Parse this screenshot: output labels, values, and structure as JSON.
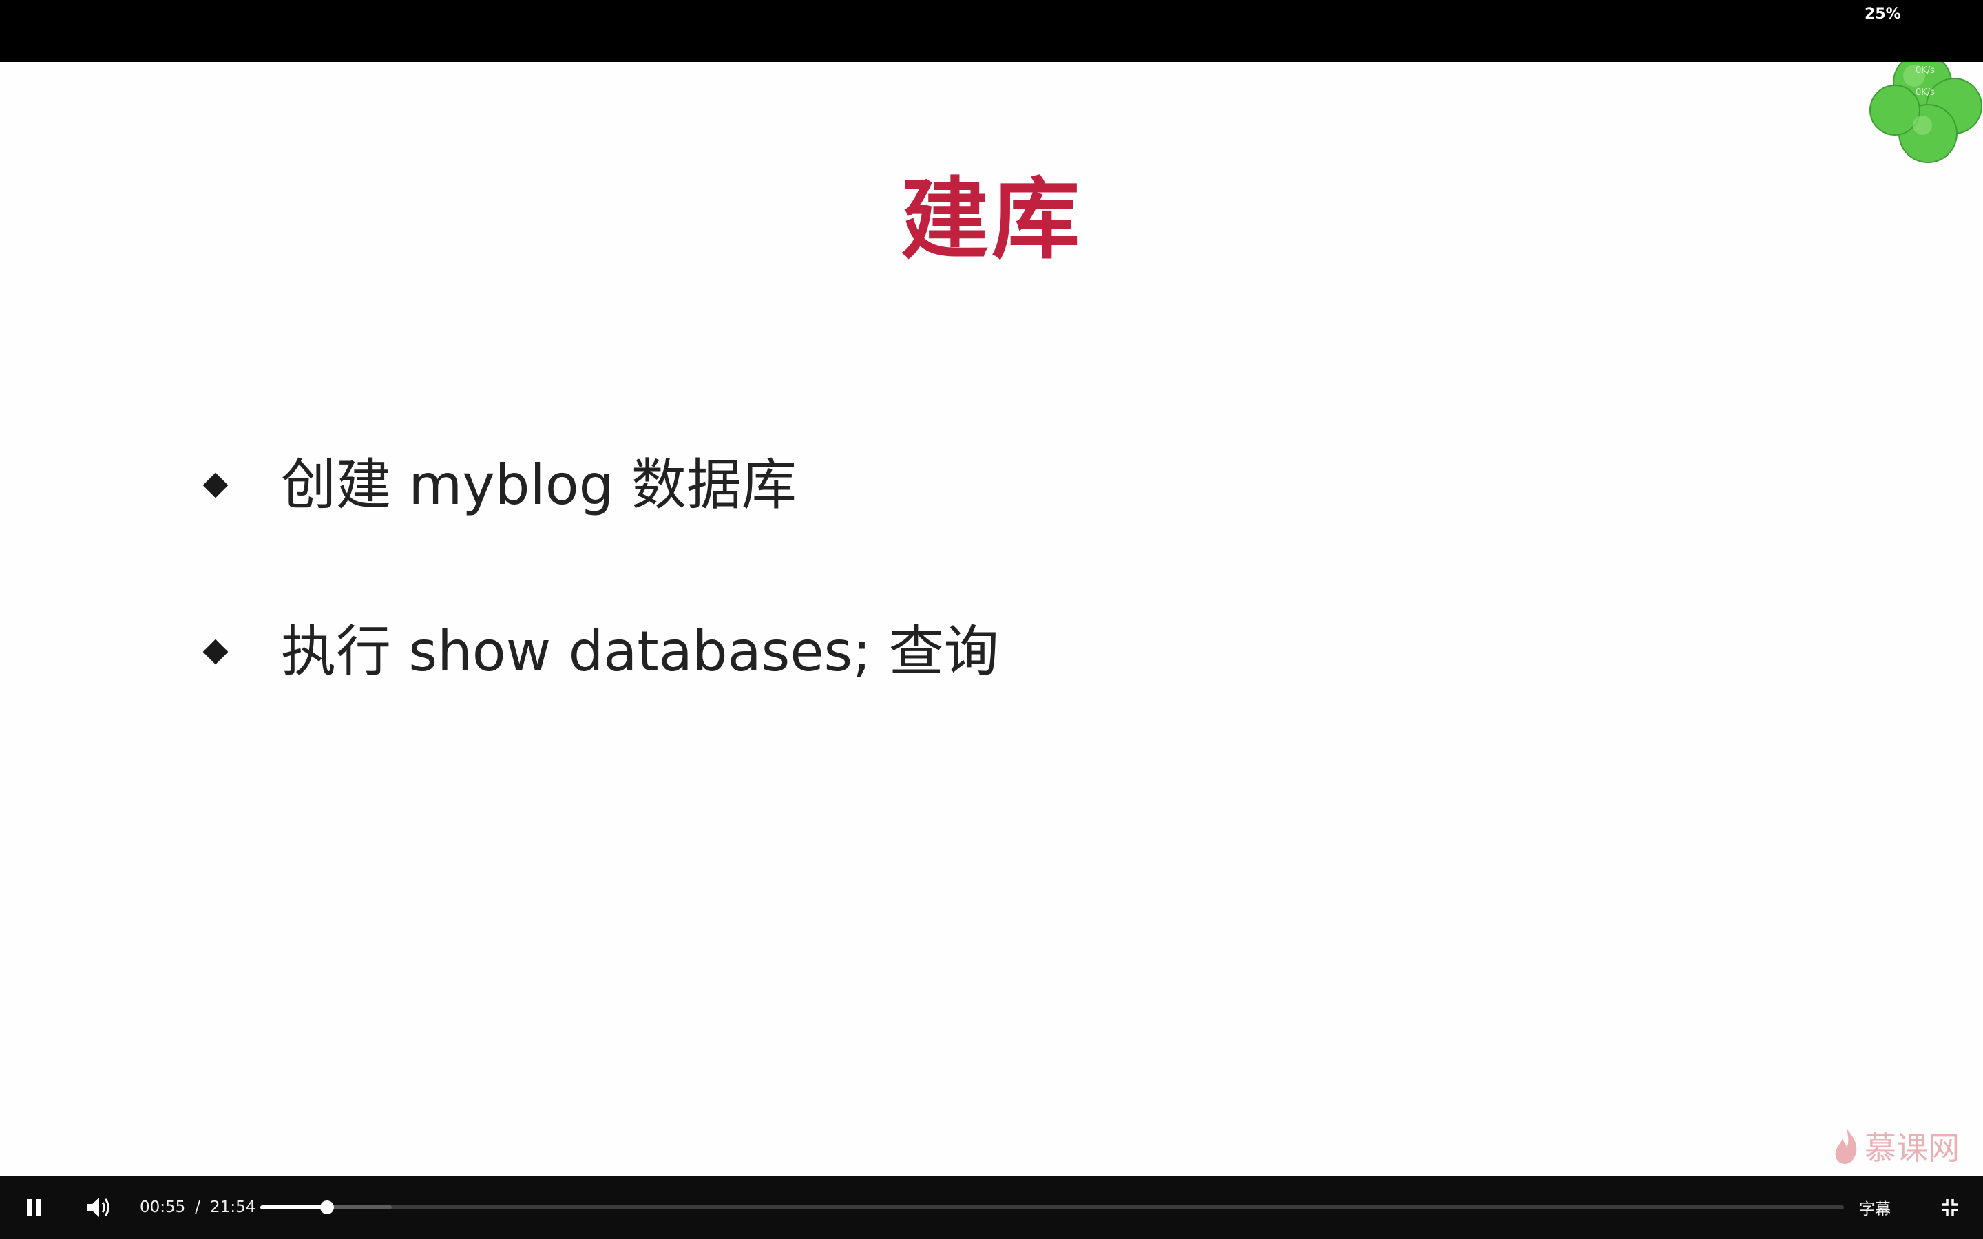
{
  "slide": {
    "title": "建库",
    "bullets": [
      {
        "text": "创建 myblog 数据库"
      },
      {
        "text": "执行 show databases; 查询"
      }
    ],
    "watermark": "慕课网",
    "title_color": "#c0213f"
  },
  "overlay_widget": {
    "percent": "25%",
    "upload_speed": "0K/s",
    "download_speed": "0K/s",
    "color": "#5cc84a"
  },
  "player": {
    "current_time": "00:55",
    "separator": "/",
    "total_time": "21:54",
    "progress_fraction": 0.042,
    "buffered_fraction": 0.083,
    "subtitle_label": "字幕",
    "icons": {
      "play_state": "pause-icon",
      "volume": "volume-icon",
      "fullscreen": "exit-fullscreen-icon"
    }
  }
}
